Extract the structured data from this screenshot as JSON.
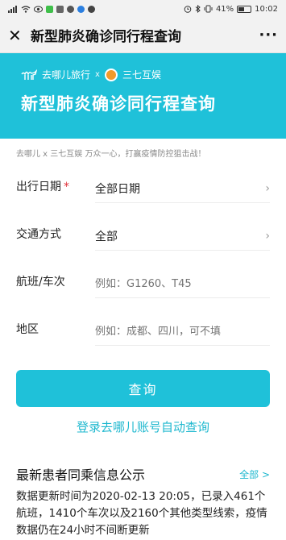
{
  "status_bar": {
    "left_icons": [
      "signal-icon",
      "wifi-icon",
      "eye-icon",
      "wechat-icon",
      "image-icon",
      "record-icon",
      "qq-icon",
      "chat-icon"
    ],
    "right_icons": [
      "alarm-icon",
      "bluetooth-icon",
      "vibrate-icon"
    ],
    "battery": "41%",
    "battery_level": 0.41,
    "time": "10:02"
  },
  "title_bar": {
    "title": "新型肺炎确诊同行程查询",
    "close_icon": "close-icon",
    "more_icon": "more-icon"
  },
  "banner": {
    "brand": "去哪儿旅行",
    "x": "x",
    "partner": "三七互娱",
    "title": "新型肺炎确诊同行程查询"
  },
  "slogan": "去哪儿 x 三七互娱 万众一心，打赢疫情防控狙击战！",
  "form": {
    "date": {
      "label": "出行日期",
      "required_mark": "*",
      "value": "全部日期"
    },
    "transport": {
      "label": "交通方式",
      "value": "全部"
    },
    "flight": {
      "label": "航班/车次",
      "placeholder": "例如：G1260、T45"
    },
    "region": {
      "label": "地区",
      "placeholder": "例如：成都、四川，可不填"
    }
  },
  "query_button": "查询",
  "login_link": "登录去哪儿账号自动查询",
  "info": {
    "title": "最新患者同乘信息公示",
    "all": "全部 >",
    "body": "数据更新时间为2020-02-13 20:05，已录入461个航班，1410个车次以及2160个其他类型线索，疫情数据仍在24小时不间断更新"
  },
  "colors": {
    "accent": "#1fc1d9",
    "link": "#1fb8cf",
    "required": "#e0323b"
  }
}
